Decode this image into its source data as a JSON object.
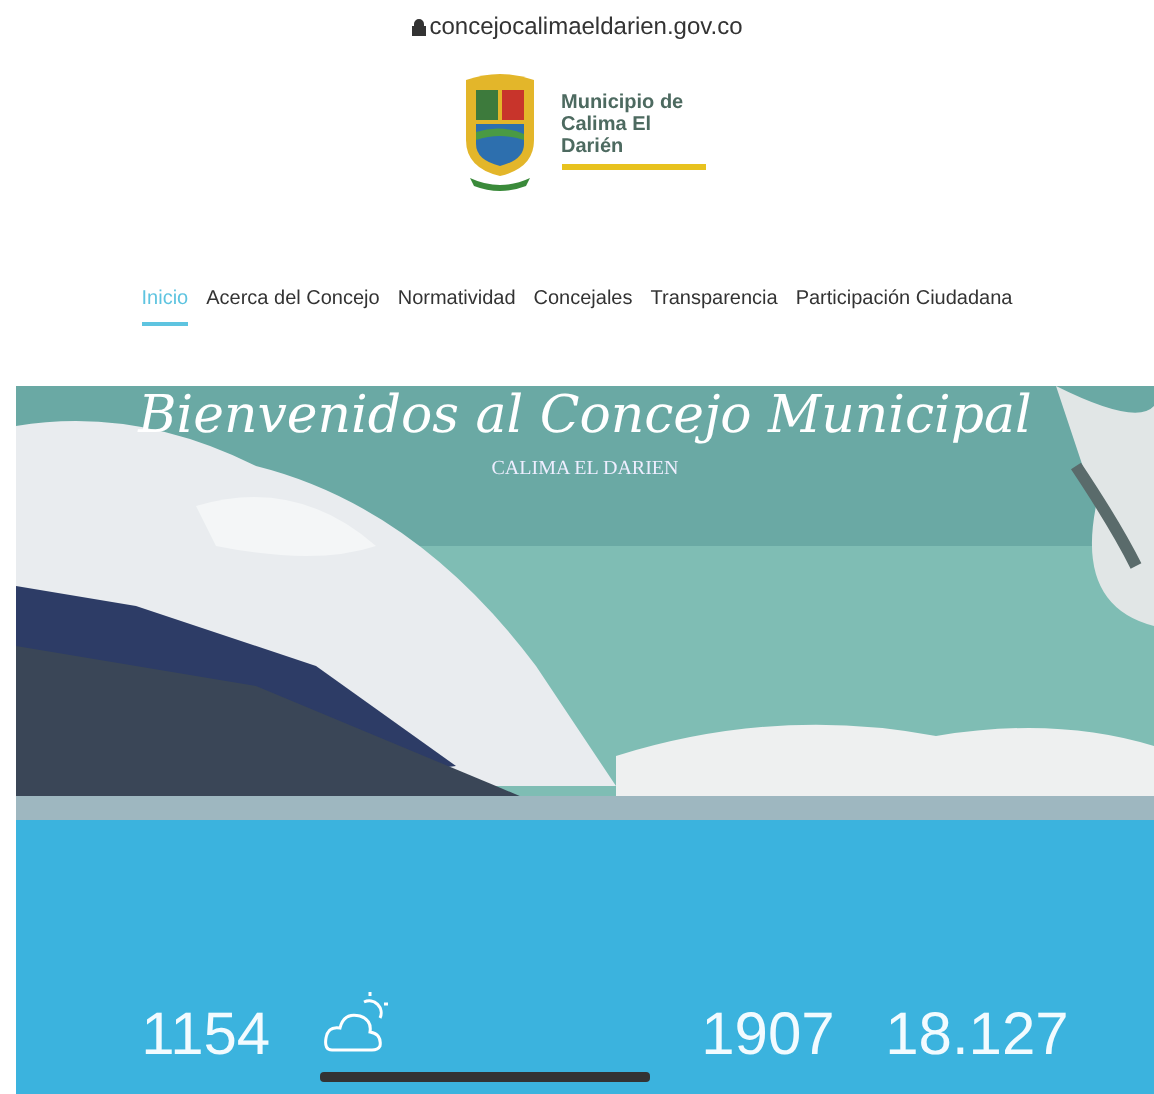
{
  "address_bar": {
    "url": "concejocalimaeldarien.gov.co"
  },
  "logo": {
    "text": "Municipio de Calima El Darién"
  },
  "nav": [
    {
      "label": "Inicio",
      "selected": true
    },
    {
      "label": "Acerca del Concejo",
      "selected": false
    },
    {
      "label": "Normatividad",
      "selected": false
    },
    {
      "label": "Concejales",
      "selected": false
    },
    {
      "label": "Transparencia",
      "selected": false
    },
    {
      "label": "Participación Ciudadana",
      "selected": false
    }
  ],
  "hero": {
    "kind": "picture",
    "title": "Bienvenidos al Concejo Municipal",
    "subtitle": "CALIMA EL DARIEN"
  },
  "stats": [
    {
      "kind": "number",
      "value": "1154"
    },
    {
      "kind": "weather"
    },
    {
      "kind": "number",
      "value": "1907"
    },
    {
      "kind": "number",
      "value": "18.127"
    }
  ]
}
